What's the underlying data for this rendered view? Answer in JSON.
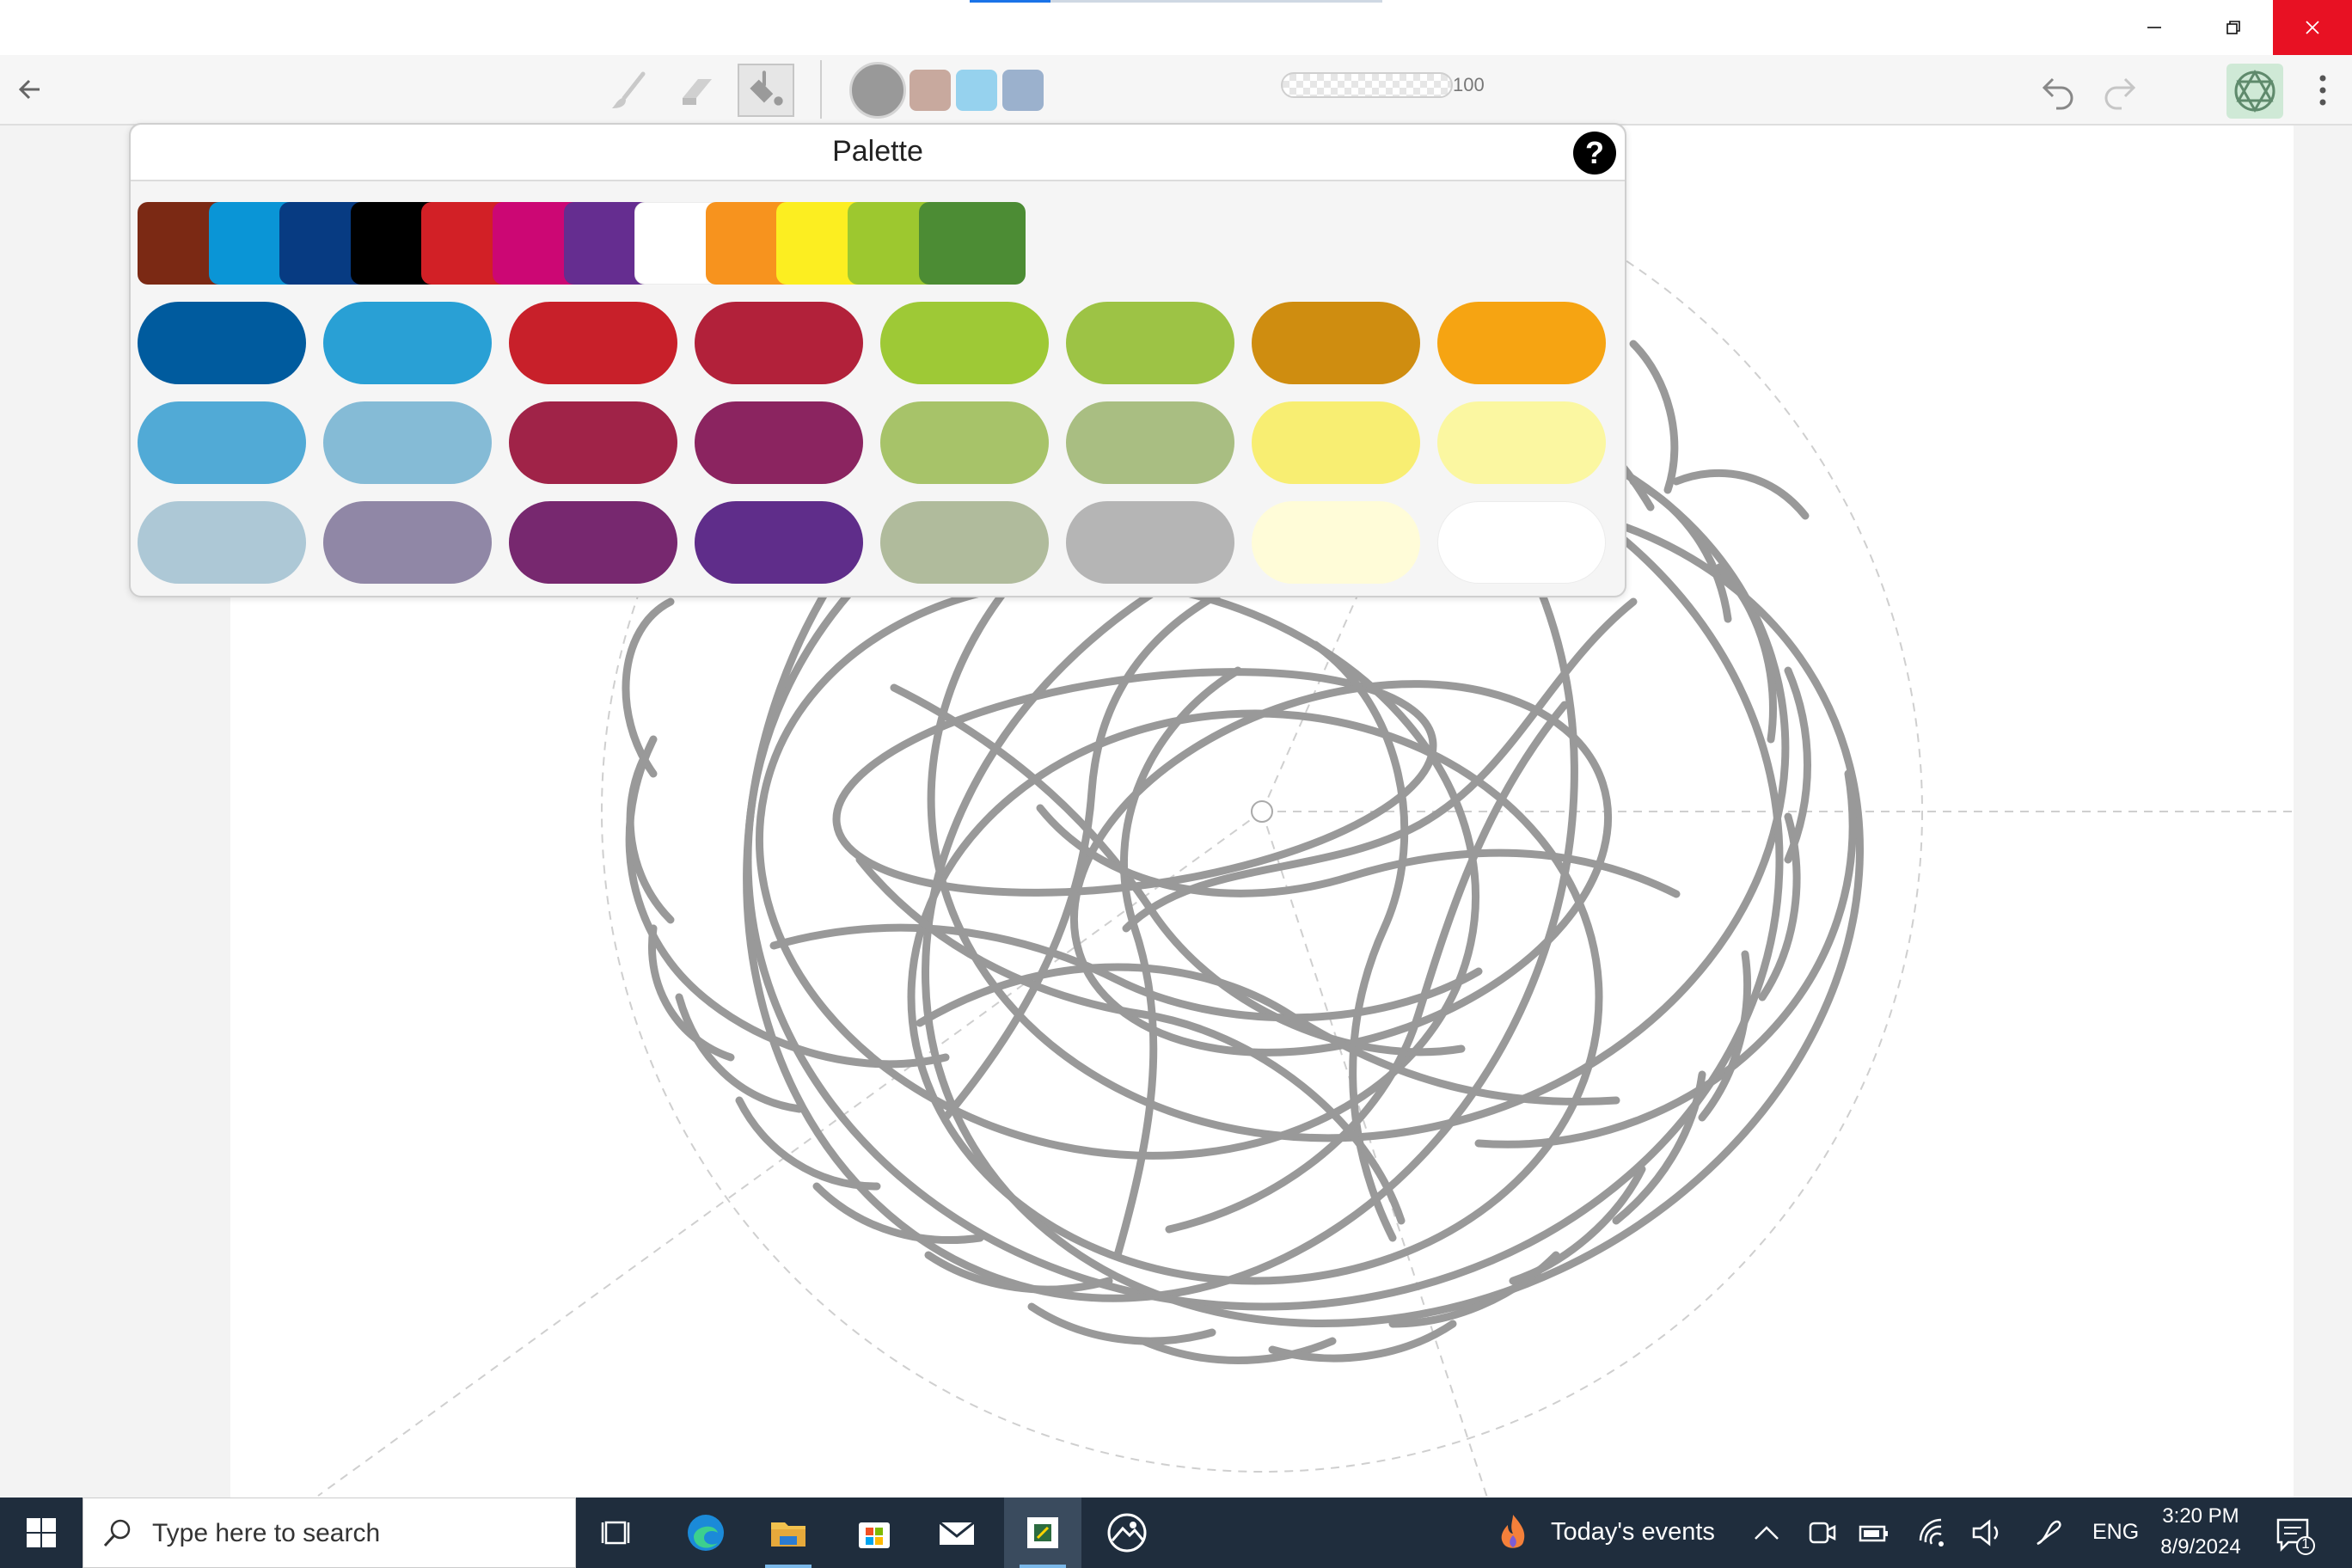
{
  "palette": {
    "title": "Palette",
    "help_label": "?",
    "basic_colors": [
      "#7b2914",
      "#0a95d6",
      "#073b82",
      "#000000",
      "#d22026",
      "#cc0774",
      "#652d90",
      "#ffffff",
      "#f7931e",
      "#fcee21",
      "#9dc82f",
      "#4c8c34"
    ],
    "rows": [
      [
        "#005b9e",
        "#29a0d5",
        "#c8202a",
        "#b2213a",
        "#9ec936",
        "#9dc345",
        "#cf8d10",
        "#f6a412"
      ],
      [
        "#51aad6",
        "#85bbd6",
        "#a02348",
        "#8b2460",
        "#a7c369",
        "#a9be82",
        "#f8ee72",
        "#fbf7a1"
      ],
      [
        "#adc8d6",
        "#9087a6",
        "#77286f",
        "#5f2d8a",
        "#b0bb9c",
        "#b5b5b5",
        "#fffcd8",
        "#ffffff"
      ]
    ]
  },
  "toolbar": {
    "back_icon": "arrow-left-icon",
    "current_color": "#999999",
    "recent_colors": [
      "#c8a99e",
      "#96d2ee",
      "#9bb1cd"
    ],
    "opacity_value": "100",
    "accent": "#4a9a6a"
  },
  "taskbar": {
    "search_placeholder": "Type here to search",
    "events_label": "Today's events",
    "language": "ENG",
    "time": "3:20 PM",
    "date": "8/9/2024",
    "notification_count": "1"
  }
}
